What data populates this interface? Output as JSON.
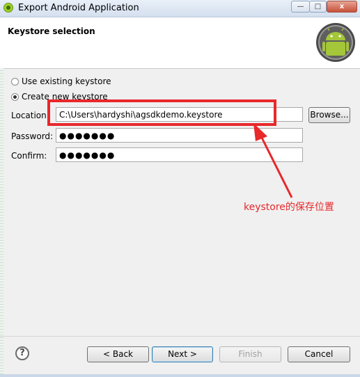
{
  "window": {
    "title": "Export Android Application",
    "minimize_label": "—",
    "maximize_label": "□",
    "close_label": "x"
  },
  "banner": {
    "title": "Keystore selection",
    "logo_icon": "android-logo-icon"
  },
  "options": {
    "use_existing_label": "Use existing keystore",
    "create_new_label": "Create new keystore",
    "selected": "create_new"
  },
  "form": {
    "location_label": "Location:",
    "location_value": "C:\\Users\\hardyshi\\agsdkdemo.keystore",
    "browse_label": "Browse...",
    "password_label": "Password:",
    "password_value": "●●●●●●●",
    "confirm_label": "Confirm:",
    "confirm_value": "●●●●●●●"
  },
  "annotation": {
    "text": "keystore的保存位置",
    "color": "#e8282b"
  },
  "footer": {
    "help_label": "?",
    "back_label": "< Back",
    "next_label": "Next >",
    "finish_label": "Finish",
    "cancel_label": "Cancel"
  }
}
